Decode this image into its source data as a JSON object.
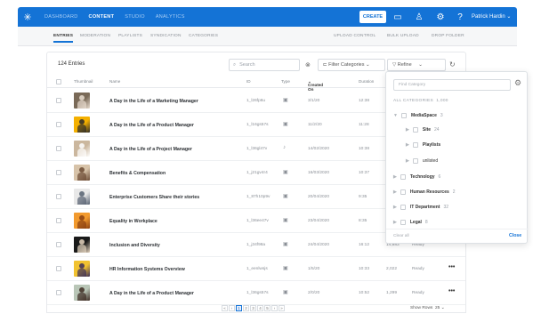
{
  "topnav": {
    "items": [
      "DASHBOARD",
      "CONTENT",
      "STUDIO",
      "ANALYTICS"
    ],
    "active": "CONTENT",
    "create_label": "CREATE",
    "user_name": "Patrick Hardin"
  },
  "subnav": {
    "tabs": [
      "ENTRIES",
      "MODERATION",
      "PLAYLISTS",
      "SYNDICATION",
      "CATEGORIES"
    ],
    "active": "ENTRIES",
    "actions": [
      "UPLOAD CONTROL",
      "BULK UPLOAD",
      "DROP FOLDER"
    ]
  },
  "toolbar": {
    "entries_count": "124 Entries",
    "search_placeholder": "Search",
    "filter_label": "Filter Categories",
    "refine_label": "Refine"
  },
  "table": {
    "headers": [
      "Thumbnail",
      "Name",
      "ID",
      "Type",
      "Created On",
      "Duration",
      "P"
    ],
    "rows": [
      {
        "name": "A Day in the Life of a Marketing Manager",
        "id": "1_l26fp6u",
        "type": "video",
        "date": "3/1/20",
        "duration": "12:38",
        "plays": "",
        "status": ""
      },
      {
        "name": "A Day in the Life of a Product Manager",
        "id": "1_l16gs57s",
        "type": "video",
        "date": "11/2/20",
        "duration": "11:28",
        "plays": "",
        "status": ""
      },
      {
        "name": "A Day in the Life of a Project Manager",
        "id": "1_l36gl47v",
        "type": "audio",
        "date": "14/02/2020",
        "duration": "10:38",
        "plays": "",
        "status": ""
      },
      {
        "name": "Benefits & Compensation",
        "id": "1_j21gv4r4",
        "type": "video",
        "date": "16/03/2020",
        "duration": "10:37",
        "plays": "",
        "status": ""
      },
      {
        "name": "Enterprise Customers Share their stories",
        "id": "1_87h10p9v",
        "type": "video",
        "date": "20/04/2020",
        "duration": "9:35",
        "plays": "",
        "status": ""
      },
      {
        "name": "Equality in Workplace",
        "id": "1_l36ee47v",
        "type": "video",
        "date": "23/04/2020",
        "duration": "8:35",
        "plays": "",
        "status": ""
      },
      {
        "name": "Inclusion and Diversity",
        "id": "1_j34f98a",
        "type": "video",
        "date": "24/04/2020",
        "duration": "16:12",
        "plays": "14,883",
        "status": "Ready"
      },
      {
        "name": "HR Information Systems Overview",
        "id": "1_eenlwsjs",
        "type": "video",
        "date": "1/5/20",
        "duration": "10:33",
        "plays": "2,022",
        "status": "Ready"
      },
      {
        "name": "A Day in the Life of a Product Manager",
        "id": "1_l36gs57s",
        "type": "video",
        "date": "2/0/20",
        "duration": "10:52",
        "plays": "1,299",
        "status": "Ready"
      }
    ]
  },
  "pager": {
    "pages": [
      "1",
      "2",
      "3",
      "4",
      "5"
    ],
    "current": "1",
    "show_rows_label": "Show Rows",
    "show_rows_value": "25"
  },
  "dropdown": {
    "find_placeholder": "Find Category",
    "all_label": "ALL CATEGORIES",
    "all_count": "1,000",
    "items": [
      {
        "label": "MediaSpace",
        "count": "3"
      },
      {
        "label": "Site",
        "count": "24"
      },
      {
        "label": "Playlists",
        "count": ""
      },
      {
        "label": "unlisted",
        "count": ""
      },
      {
        "label": "Technology",
        "count": "6"
      },
      {
        "label": "Human Resources",
        "count": "2"
      },
      {
        "label": "IT Department",
        "count": "32"
      },
      {
        "label": "Legal",
        "count": "8"
      }
    ],
    "clear_label": "Clear all",
    "close_label": "Close"
  }
}
